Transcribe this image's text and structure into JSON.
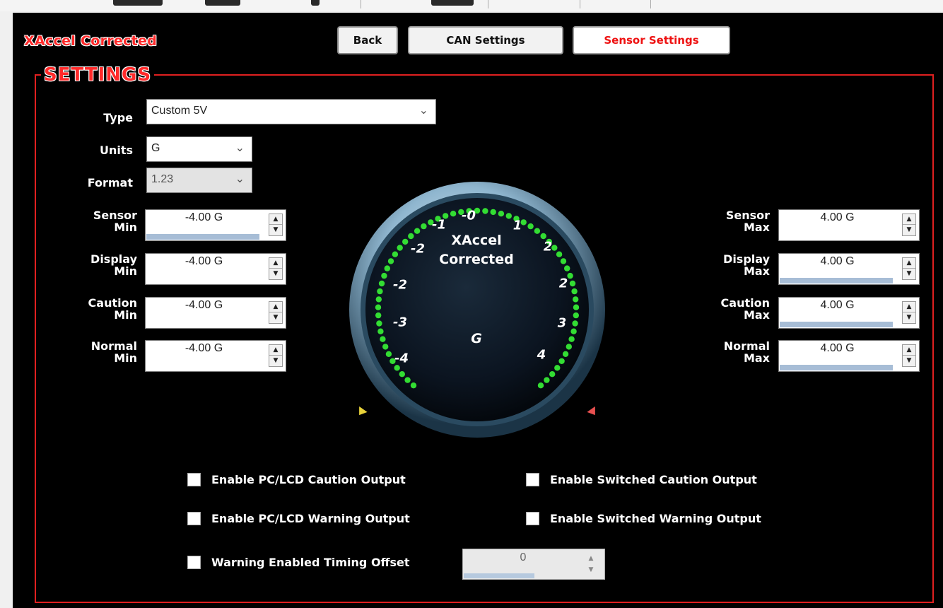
{
  "app_title": "XAccel Corrected",
  "nav": {
    "back": "Back",
    "can_settings": "CAN Settings",
    "sensor_settings": "Sensor Settings"
  },
  "group_title": "SETTINGS",
  "type": {
    "label": "Type",
    "value": "Custom 5V"
  },
  "units": {
    "label": "Units",
    "value": "G"
  },
  "format": {
    "label": "Format",
    "value": "1.23"
  },
  "fields_left": [
    {
      "label1": "Sensor",
      "label2": "Min",
      "value": "-4.00 G",
      "level": 0.8
    },
    {
      "label1": "Display",
      "label2": "Min",
      "value": "-4.00 G",
      "level": 0.0
    },
    {
      "label1": "Caution",
      "label2": "Min",
      "value": "-4.00 G",
      "level": 0.0
    },
    {
      "label1": "Normal",
      "label2": "Min",
      "value": "-4.00 G",
      "level": 0.0
    }
  ],
  "fields_right": [
    {
      "label1": "Sensor",
      "label2": "Max",
      "value": "4.00 G",
      "level": 0.0
    },
    {
      "label1": "Display",
      "label2": "Max",
      "value": "4.00 G",
      "level": 0.8
    },
    {
      "label1": "Caution",
      "label2": "Max",
      "value": "4.00 G",
      "level": 0.8
    },
    {
      "label1": "Normal",
      "label2": "Max",
      "value": "4.00 G",
      "level": 0.8
    }
  ],
  "gauge": {
    "title_line1": "XAccel",
    "title_line2": "Corrected",
    "unit": "G",
    "ticks": [
      "-4",
      "-3",
      "-2",
      "-2",
      "-1",
      "-0",
      "1",
      "2",
      "2",
      "3",
      "4"
    ],
    "led_color": "#33dd33",
    "caution_marker_color": "#e8d23a",
    "warning_marker_color": "#e85050"
  },
  "checkboxes": {
    "pc_caution": "Enable PC/LCD Caution Output",
    "switched_caution": "Enable Switched Caution Output",
    "pc_warning": "Enable PC/LCD Warning Output",
    "switched_warning": "Enable Switched Warning Output",
    "timing_offset": "Warning Enabled Timing Offset"
  },
  "timing_offset_value": "0",
  "colors": {
    "accent_red": "#ff2a2a",
    "panel_bg": "#000000",
    "bar_blue": "#a7bdd6"
  }
}
